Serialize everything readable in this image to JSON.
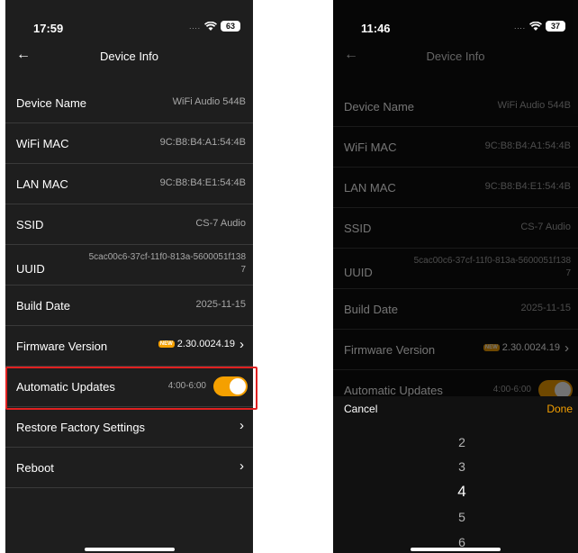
{
  "screen_left": {
    "status_bar": {
      "time": "17:59",
      "signal_dots": "....",
      "battery": "63"
    },
    "nav": {
      "back_icon": "←",
      "title": "Device Info"
    },
    "rows": [
      {
        "label": "Device Name",
        "value": "WiFi Audio 544B"
      },
      {
        "label": "WiFi MAC",
        "value": "9C:B8:B4:A1:54:4B"
      },
      {
        "label": "LAN MAC",
        "value": "9C:B8:B4:E1:54:4B"
      },
      {
        "label": "SSID",
        "value": "CS-7 Audio"
      },
      {
        "label": "UUID",
        "value_line1": "5cac00c6-37cf-11f0-813a-5600051f138",
        "value_line2": "7"
      },
      {
        "label": "Build Date",
        "value": "2025-11-15"
      }
    ],
    "firmware": {
      "label": "Firmware Version",
      "badge": "NEW",
      "value": "2.30.0024.19",
      "chevron": "›"
    },
    "auto_updates": {
      "label": "Automatic Updates",
      "time_range": "4:00-6:00",
      "enabled": true
    },
    "restore": {
      "label": "Restore Factory Settings",
      "chevron": "›"
    },
    "reboot": {
      "label": "Reboot",
      "chevron": "›"
    }
  },
  "screen_right": {
    "status_bar": {
      "time": "11:46",
      "signal_dots": "....",
      "battery": "37"
    },
    "nav": {
      "back_icon": "←",
      "title": "Device Info"
    },
    "rows": [
      {
        "label": "Device Name",
        "value": "WiFi Audio 544B"
      },
      {
        "label": "WiFi MAC",
        "value": "9C:B8:B4:A1:54:4B"
      },
      {
        "label": "LAN MAC",
        "value": "9C:B8:B4:E1:54:4B"
      },
      {
        "label": "SSID",
        "value": "CS-7 Audio"
      },
      {
        "label": "UUID",
        "value_line1": "5cac00c6-37cf-11f0-813a-5600051f138",
        "value_line2": "7"
      },
      {
        "label": "Build Date",
        "value": "2025-11-15"
      }
    ],
    "firmware": {
      "label": "Firmware Version",
      "badge": "NEW",
      "value": "2.30.0024.19",
      "chevron": "›"
    },
    "auto_updates": {
      "label": "Automatic Updates",
      "time_range": "4:00-6:00"
    },
    "picker": {
      "cancel": "Cancel",
      "done": "Done",
      "options": [
        "2",
        "3",
        "4",
        "5",
        "6"
      ],
      "selected": "4"
    }
  },
  "colors": {
    "accent": "#f5a000",
    "highlight": "#e02020",
    "background_left": "#1e1e1e",
    "background_right": "#0f0f0f"
  }
}
